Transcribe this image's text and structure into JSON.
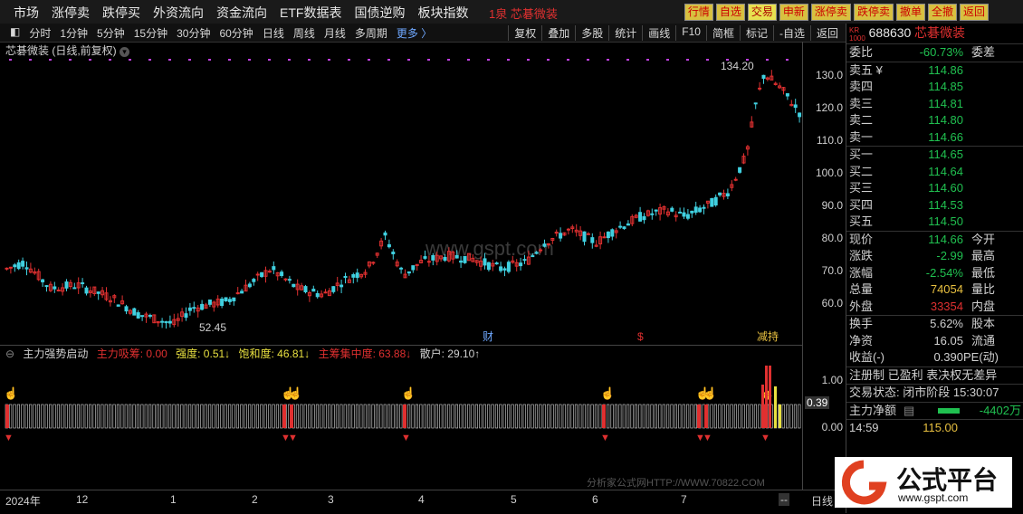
{
  "topbar": {
    "menu": [
      "市场",
      "涨停卖",
      "跌停买",
      "外资流向",
      "资金流向",
      "ETF数据表",
      "国债逆购",
      "板块指数"
    ],
    "stock_tag": "1泉 芯碁微装",
    "quick": [
      "行情",
      "自选",
      "交易",
      "申新",
      "涨停卖",
      "跌停卖",
      "撤单",
      "全撤",
      "返回"
    ]
  },
  "toolbar": {
    "periods": [
      "分时",
      "1分钟",
      "5分钟",
      "15分钟",
      "30分钟",
      "60分钟",
      "日线",
      "周线",
      "月线",
      "多周期"
    ],
    "more": "更多 〉",
    "tools": [
      "复权",
      "叠加",
      "多股",
      "统计",
      "画线",
      "F10",
      "简框",
      "标记",
      "-自选",
      "返回"
    ]
  },
  "chart": {
    "title": "芯碁微装 (日线,前复权)",
    "price_ticks": [
      "130.0",
      "120.0",
      "110.0",
      "100.0",
      "90.0",
      "80.0",
      "70.0",
      "60.0"
    ],
    "high_label": "134.20",
    "low_label": "52.45",
    "watermark": "www.gspt.com",
    "markers": [
      "财",
      "$",
      "减持"
    ]
  },
  "indicator": {
    "name": "主力强势启动",
    "items": [
      {
        "label": "主力吸筹: 0.00",
        "color": "#e03030"
      },
      {
        "label": "强度: 0.51↓",
        "color": "#e8e040"
      },
      {
        "label": "饱和度: 46.81↓",
        "color": "#e8e040"
      },
      {
        "label": "主筹集中度: 63.88↓",
        "color": "#e03030"
      },
      {
        "label": "散户: 29.10↑",
        "color": "#d0d0d0"
      }
    ],
    "ticks": [
      "1.00",
      "0.39",
      "0.00"
    ],
    "footer_watermark": "分析家公式网HTTP://WWW.70822.COM"
  },
  "time_axis": [
    "2024年",
    "12",
    "1",
    "2",
    "3",
    "4",
    "5",
    "6",
    "7",
    "--"
  ],
  "time_axis_right": "日线",
  "quote": {
    "market_tag": "KR 1000",
    "code": "688630",
    "name": "芯碁微装",
    "weibi_label": "委比",
    "weibi_value": "-60.73%",
    "weicha_label": "委差",
    "sells": [
      {
        "k": "卖五 ¥",
        "v": "114.86"
      },
      {
        "k": "卖四",
        "v": "114.85"
      },
      {
        "k": "卖三",
        "v": "114.81"
      },
      {
        "k": "卖二",
        "v": "114.80"
      },
      {
        "k": "卖一",
        "v": "114.66"
      }
    ],
    "buys": [
      {
        "k": "买一",
        "v": "114.65"
      },
      {
        "k": "买二",
        "v": "114.64"
      },
      {
        "k": "买三",
        "v": "114.60"
      },
      {
        "k": "买四",
        "v": "114.53"
      },
      {
        "k": "买五",
        "v": "114.50"
      }
    ],
    "stats": [
      {
        "k": "现价",
        "v": "114.66",
        "v2": "今开",
        "c": "#20c050"
      },
      {
        "k": "涨跌",
        "v": "-2.99",
        "v2": "最高",
        "c": "#20c050"
      },
      {
        "k": "涨幅",
        "v": "-2.54%",
        "v2": "最低",
        "c": "#20c050"
      },
      {
        "k": "总量",
        "v": "74054",
        "v2": "量比",
        "c": "#e8c040"
      },
      {
        "k": "外盘",
        "v": "33354",
        "v2": "内盘",
        "c": "#e03030"
      }
    ],
    "stats2": [
      {
        "k": "换手",
        "v": "5.62%",
        "v2": "股本"
      },
      {
        "k": "净资",
        "v": "16.05",
        "v2": "流通"
      },
      {
        "k": "收益(-)",
        "v": "0.390",
        "v2": "PE(动)"
      }
    ],
    "info1": "注册制 已盈利 表决权无差异",
    "info2": "交易状态: 闭市阶段 15:30:07",
    "net_label": "主力净额",
    "net_value": "-4402万",
    "tick_time": "14:59",
    "tick_price": "115.00"
  },
  "logo": {
    "text": "公式平台",
    "url": "www.gspt.com"
  }
}
